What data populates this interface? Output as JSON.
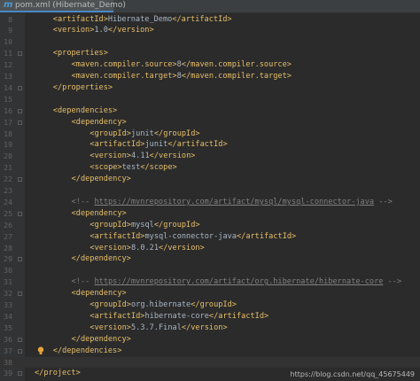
{
  "tab": {
    "icon": "m",
    "label": "pom.xml (Hibernate_Demo)"
  },
  "lines": [
    {
      "n": "8",
      "indent": 2,
      "parts": [
        [
          "t",
          "<artifactId>"
        ],
        [
          "x",
          "Hibernate_Demo"
        ],
        [
          "t",
          "</artifactId>"
        ]
      ]
    },
    {
      "n": "9",
      "indent": 2,
      "parts": [
        [
          "t",
          "<version>"
        ],
        [
          "x",
          "1.0"
        ],
        [
          "t",
          "</version>"
        ]
      ]
    },
    {
      "n": "10",
      "indent": 0,
      "parts": []
    },
    {
      "n": "11",
      "indent": 2,
      "fold": true,
      "parts": [
        [
          "t",
          "<properties>"
        ]
      ]
    },
    {
      "n": "12",
      "indent": 4,
      "parts": [
        [
          "t",
          "<maven.compiler.source>"
        ],
        [
          "x",
          "8"
        ],
        [
          "t",
          "</maven.compiler.source>"
        ]
      ]
    },
    {
      "n": "13",
      "indent": 4,
      "parts": [
        [
          "t",
          "<maven.compiler.target>"
        ],
        [
          "x",
          "8"
        ],
        [
          "t",
          "</maven.compiler.target>"
        ]
      ]
    },
    {
      "n": "14",
      "indent": 2,
      "fold": true,
      "parts": [
        [
          "t",
          "</properties>"
        ]
      ]
    },
    {
      "n": "15",
      "indent": 0,
      "parts": []
    },
    {
      "n": "16",
      "indent": 2,
      "fold": true,
      "parts": [
        [
          "t",
          "<dependencies>"
        ]
      ]
    },
    {
      "n": "17",
      "indent": 4,
      "fold": true,
      "parts": [
        [
          "t",
          "<dependency>"
        ]
      ]
    },
    {
      "n": "18",
      "indent": 6,
      "parts": [
        [
          "t",
          "<groupId>"
        ],
        [
          "x",
          "junit"
        ],
        [
          "t",
          "</groupId>"
        ]
      ]
    },
    {
      "n": "19",
      "indent": 6,
      "parts": [
        [
          "t",
          "<artifactId>"
        ],
        [
          "x",
          "junit"
        ],
        [
          "t",
          "</artifactId>"
        ]
      ]
    },
    {
      "n": "20",
      "indent": 6,
      "parts": [
        [
          "t",
          "<version>"
        ],
        [
          "x",
          "4.11"
        ],
        [
          "t",
          "</version>"
        ]
      ]
    },
    {
      "n": "21",
      "indent": 6,
      "parts": [
        [
          "t",
          "<scope>"
        ],
        [
          "x",
          "test"
        ],
        [
          "t",
          "</scope>"
        ]
      ]
    },
    {
      "n": "22",
      "indent": 4,
      "fold": true,
      "parts": [
        [
          "t",
          "</dependency>"
        ]
      ]
    },
    {
      "n": "23",
      "indent": 0,
      "parts": []
    },
    {
      "n": "24",
      "indent": 4,
      "parts": [
        [
          "c",
          "<!-- "
        ],
        [
          "u",
          "https://mvnrepository.com/artifact/mysql/mysql-connector-java"
        ],
        [
          "c",
          " -->"
        ]
      ]
    },
    {
      "n": "25",
      "indent": 4,
      "fold": true,
      "parts": [
        [
          "t",
          "<dependency>"
        ]
      ]
    },
    {
      "n": "26",
      "indent": 6,
      "parts": [
        [
          "t",
          "<groupId>"
        ],
        [
          "x",
          "mysql"
        ],
        [
          "t",
          "</groupId>"
        ]
      ]
    },
    {
      "n": "27",
      "indent": 6,
      "parts": [
        [
          "t",
          "<artifactId>"
        ],
        [
          "x",
          "mysql-connector-java"
        ],
        [
          "t",
          "</artifactId>"
        ]
      ]
    },
    {
      "n": "28",
      "indent": 6,
      "parts": [
        [
          "t",
          "<version>"
        ],
        [
          "x",
          "8.0.21"
        ],
        [
          "t",
          "</version>"
        ]
      ]
    },
    {
      "n": "29",
      "indent": 4,
      "fold": true,
      "parts": [
        [
          "t",
          "</dependency>"
        ]
      ]
    },
    {
      "n": "30",
      "indent": 0,
      "parts": []
    },
    {
      "n": "31",
      "indent": 4,
      "parts": [
        [
          "c",
          "<!-- "
        ],
        [
          "u",
          "https://mvnrepository.com/artifact/org.hibernate/hibernate-core"
        ],
        [
          "c",
          " -->"
        ]
      ]
    },
    {
      "n": "32",
      "indent": 4,
      "fold": true,
      "parts": [
        [
          "t",
          "<dependency>"
        ]
      ]
    },
    {
      "n": "33",
      "indent": 6,
      "parts": [
        [
          "t",
          "<groupId>"
        ],
        [
          "x",
          "org.hibernate"
        ],
        [
          "t",
          "</groupId>"
        ]
      ]
    },
    {
      "n": "34",
      "indent": 6,
      "parts": [
        [
          "t",
          "<artifactId>"
        ],
        [
          "x",
          "hibernate-core"
        ],
        [
          "t",
          "</artifactId>"
        ]
      ]
    },
    {
      "n": "35",
      "indent": 6,
      "parts": [
        [
          "t",
          "<version>"
        ],
        [
          "x",
          "5.3.7.Final"
        ],
        [
          "t",
          "</version>"
        ]
      ]
    },
    {
      "n": "36",
      "indent": 4,
      "fold": true,
      "parts": [
        [
          "t",
          "</dependency>"
        ]
      ]
    },
    {
      "n": "37",
      "indent": 2,
      "fold": true,
      "bulb": true,
      "parts": [
        [
          "t",
          "</dependencies>"
        ]
      ]
    },
    {
      "n": "38",
      "indent": 0,
      "current": true,
      "parts": []
    },
    {
      "n": "39",
      "indent": 0,
      "fold": true,
      "parts": [
        [
          "t",
          "</project>"
        ]
      ]
    }
  ],
  "watermark": "https://blog.csdn.net/qq_45675449",
  "colors": {
    "tag": "#e8bf6a",
    "text": "#a9b7c6",
    "comment": "#808080",
    "background": "#2b2b2b"
  }
}
